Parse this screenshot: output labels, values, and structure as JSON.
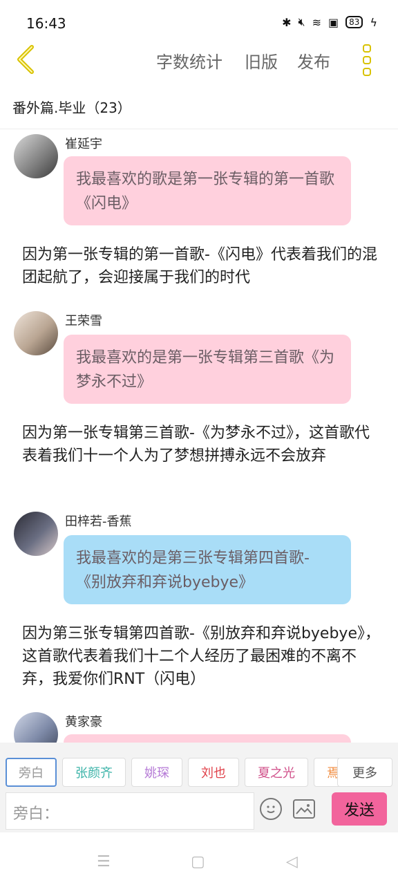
{
  "status": {
    "time": "16:43",
    "battery": "83"
  },
  "toolbar": {
    "word_count": "字数统计",
    "old_version": "旧版",
    "publish": "发布"
  },
  "chapter": {
    "title": "番外篇.毕业（23）"
  },
  "messages": [
    {
      "speaker": "崔延宇",
      "text": "我最喜欢的歌是第一张专辑的第一首歌《闪电》",
      "bubble_color": "#ffd0dd"
    },
    {
      "speaker": "王荣雪",
      "text": "我最喜欢的是第一张专辑第三首歌《为梦永不过》",
      "bubble_color": "#ffd0dd"
    },
    {
      "speaker": "田梓若-香蕉",
      "text": "我最喜欢的是第三张专辑第四首歌-《别放弃和弃说byebye》",
      "bubble_color": "#a9ddf7"
    },
    {
      "speaker": "黄家豪",
      "text": "",
      "bubble_color": "#ffd0dd"
    }
  ],
  "narrations": [
    "因为第一张专辑的第一首歌-《闪电》代表着我们的混团起航了，会迎接属于我们的时代",
    "因为第一张专辑第三首歌-《为梦永不过》，这首歌代表着我们十一个人为了梦想拼搏永远不会放弃",
    "因为第三张专辑第四首歌-《别放弃和弃说byebye》，这首歌代表着我们十二个人经历了最困难的不离不弃，我爱你们RNT（闪电）"
  ],
  "roles": [
    {
      "label": "旁白",
      "color": "#999999"
    },
    {
      "label": "张颜齐",
      "color": "#3bb3a8"
    },
    {
      "label": "姚琛",
      "color": "#b57ad6"
    },
    {
      "label": "刘也",
      "color": "#e0414a"
    },
    {
      "label": "夏之光",
      "color": "#d0508a"
    },
    {
      "label": "焉",
      "color": "#f08a3c"
    }
  ],
  "more": "更多",
  "input": {
    "placeholder": "旁白："
  },
  "send": "发送"
}
